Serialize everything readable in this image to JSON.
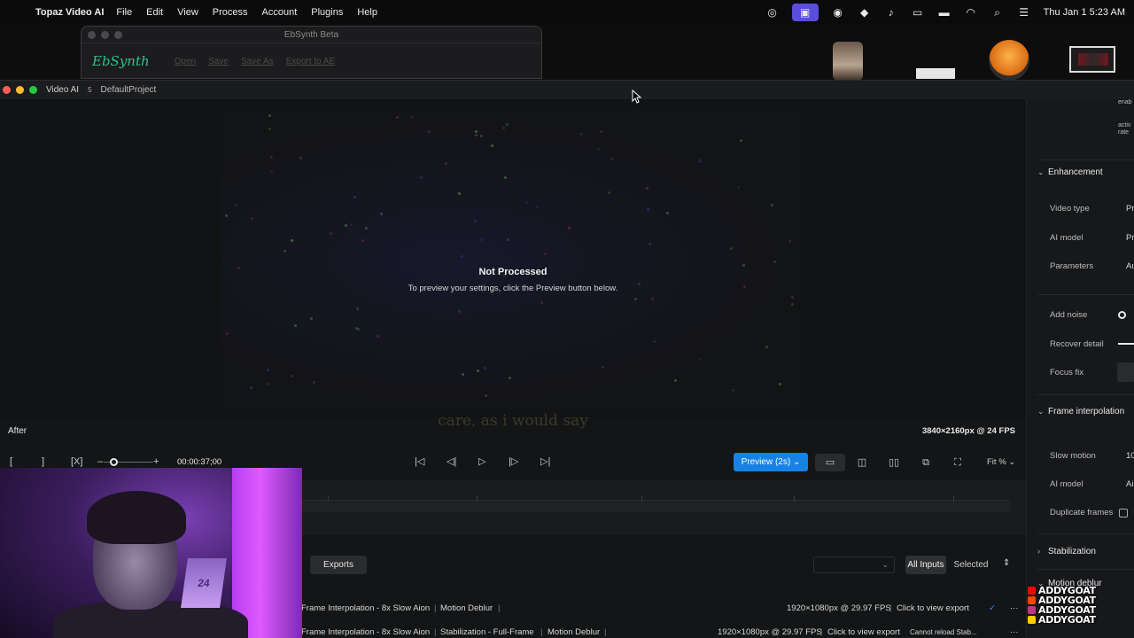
{
  "menubar": {
    "app_name": "Topaz Video AI",
    "items": [
      "File",
      "Edit",
      "View",
      "Process",
      "Account",
      "Plugins",
      "Help"
    ],
    "clock": "Thu Jan 1  5:23 AM"
  },
  "ebsynth": {
    "title": "EbSynth Beta",
    "logo": "EbSynth",
    "buttons": [
      "Open",
      "Save",
      "Save As",
      "Export to AE"
    ]
  },
  "window": {
    "app": "Video AI",
    "badge": "5",
    "project": "DefaultProject"
  },
  "preview": {
    "status_title": "Not Processed",
    "status_sub": "To preview your settings, click the Preview button below.",
    "subtitle_text": "care, as i would say",
    "view_label": "After",
    "resolution": "3840×2160px @ 24 FPS"
  },
  "transport": {
    "mark_in": "[",
    "mark_out": "]",
    "clear_marks": "[X]",
    "zoom_minus": "–",
    "zoom_plus": "+",
    "timecode": "00:00:37;00",
    "preview_button": "Preview (2s)",
    "fit_label": "Fit %",
    "zoom_level": 0.2
  },
  "exports": {
    "tab_label": "Exports",
    "filter_all": "All Inputs",
    "filter_selected": "Selected",
    "rows": [
      {
        "filters": [
          "Frame Interpolation - 8x Slow Aion",
          "Motion Deblur"
        ],
        "format": "1920×1080px @ 29.97 FPS",
        "action": "Click to view export",
        "status": ""
      },
      {
        "filters": [
          "Frame Interpolation - 8x Slow Aion",
          "Stabilization - Full-Frame",
          "Motion Deblur"
        ],
        "format": "1920×1080px @ 29.97 FPS",
        "action": "Click to view export",
        "status": "Cannot reload Stab..."
      }
    ]
  },
  "panel": {
    "enhancement": {
      "title": "Enhancement",
      "video_type_label": "Video type",
      "video_type_value": "Pr",
      "ai_model_label": "AI model",
      "ai_model_value": "Pr",
      "parameters_label": "Parameters",
      "parameters_value": "Au",
      "add_noise_label": "Add noise",
      "recover_detail_label": "Recover detail",
      "focus_fix_label": "Focus fix"
    },
    "frame_interpolation": {
      "title": "Frame interpolation",
      "slow_motion_label": "Slow motion",
      "slow_motion_value": "10",
      "ai_model_label": "AI model",
      "ai_model_value": "Ai",
      "duplicate_frames_label": "Duplicate frames"
    },
    "stabilization": {
      "title": "Stabilization"
    },
    "motion_deblur": {
      "title": "Motion deblur"
    }
  },
  "socials": {
    "handles": [
      "ADDYGOAT",
      "ADDYGOAT",
      "ADDYGOAT",
      "ADDYGOAT"
    ],
    "colors": [
      "#ff0000",
      "#ff4500",
      "#c13584",
      "#ffcc00"
    ]
  },
  "colors": {
    "accent": "#1682e6",
    "traffic_red": "#ff5f57",
    "traffic_yellow": "#febc2e",
    "traffic_green": "#28c840"
  }
}
